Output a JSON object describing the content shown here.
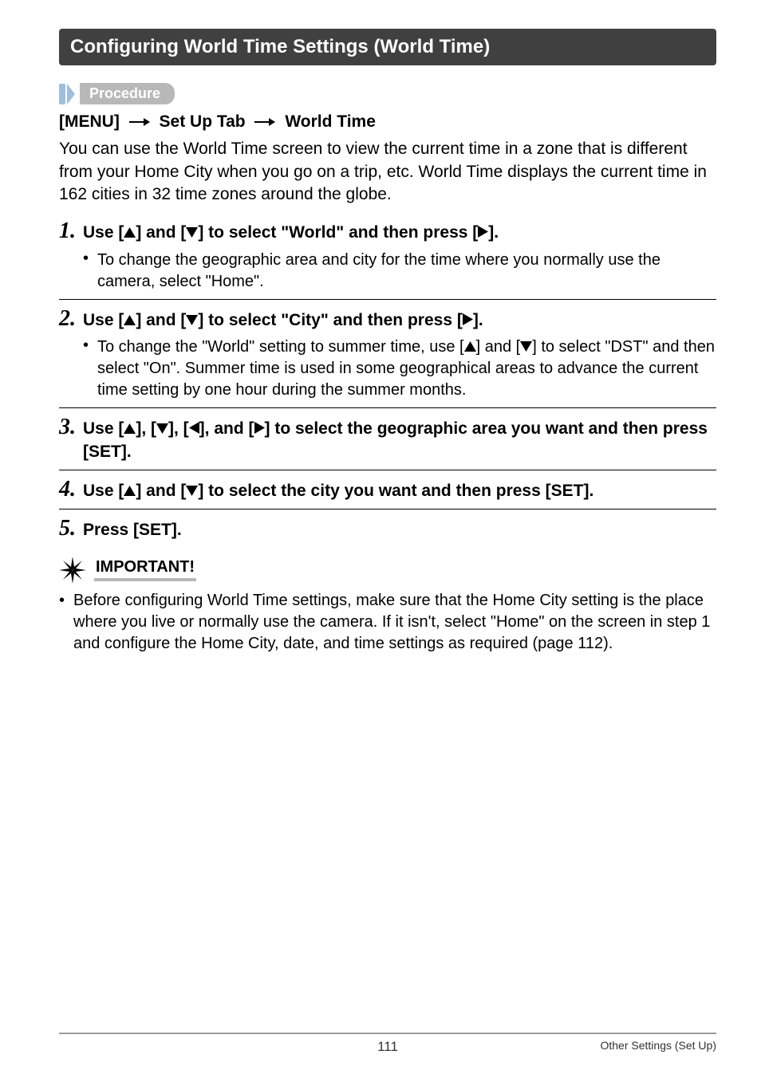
{
  "section_title": "Configuring World Time Settings (World Time)",
  "procedure_label": "Procedure",
  "menu_line": {
    "part1": "[MENU]",
    "part2": "Set Up Tab",
    "part3": "World Time"
  },
  "intro": "You can use the World Time screen to view the current time in a zone that is different from your Home City when you go on a trip, etc. World Time displays the current time in 162 cities in 32 time zones around the globe.",
  "steps": [
    {
      "num": "1.",
      "text_pre": "Use [",
      "text_mid1": "] and [",
      "text_mid2": "] to select \"World\" and then press [",
      "text_post": "].",
      "tri1": "up",
      "tri2": "down",
      "tri3": "right",
      "sub": "To change the geographic area and city for the time where you normally use the camera, select \"Home\"."
    },
    {
      "num": "2.",
      "text_pre": "Use [",
      "text_mid1": "] and [",
      "text_mid2": "] to select \"City\" and then press [",
      "text_post": "].",
      "tri1": "up",
      "tri2": "down",
      "tri3": "right",
      "sub_pre": "To change the \"World\" setting to summer time, use [",
      "sub_mid": "] and [",
      "sub_post": "] to select \"DST\" and then select \"On\". Summer time is used in some geographical areas to advance the current time setting by one hour during the summer months.",
      "sub_tri1": "up",
      "sub_tri2": "down"
    },
    {
      "num": "3.",
      "text_pre": "Use [",
      "text_a": "], [",
      "text_b": "], [",
      "text_c": "], and [",
      "text_post": "] to select the geographic area you want and then press [SET].",
      "tri1": "up",
      "tri2": "down",
      "tri3": "left",
      "tri4": "right"
    },
    {
      "num": "4.",
      "text_pre": "Use [",
      "text_mid1": "] and [",
      "text_post": "] to select the city you want and then press [SET].",
      "tri1": "up",
      "tri2": "down"
    },
    {
      "num": "5.",
      "text": "Press [SET]."
    }
  ],
  "important": {
    "label": "IMPORTANT!",
    "text": "Before configuring World Time settings, make sure that the Home City setting is the place where you live or normally use the camera. If it isn't, select \"Home\" on the screen in step 1 and configure the Home City, date, and time settings as required (page 112)."
  },
  "footer": {
    "page": "111",
    "chapter": "Other Settings (Set Up)"
  }
}
